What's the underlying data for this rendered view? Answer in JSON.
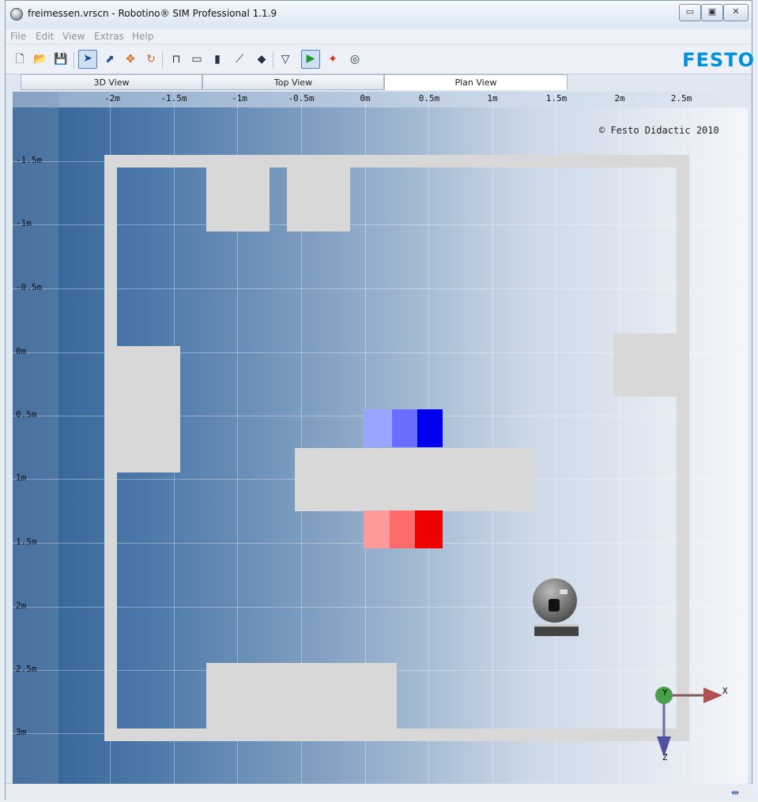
{
  "window": {
    "title": "freimessen.vrscn - Robotino® SIM Professional 1.1.9",
    "minimize_glyph": "▭",
    "maximize_glyph": "▣",
    "close_glyph": "✕"
  },
  "menu": [
    "File",
    "Edit",
    "View",
    "Extras",
    "Help"
  ],
  "toolbar": {
    "icons": [
      "new-file-icon",
      "open-folder-icon",
      "save-icon",
      "select-arrow-icon",
      "pointer-icon",
      "move-icon",
      "rotate-icon",
      "ruler-corner-icon",
      "ruler-icon",
      "marker-icon",
      "line-icon",
      "wall-icon",
      "polygon-icon",
      "play-icon",
      "color-objects-icon",
      "camera-icon"
    ],
    "glyphs": [
      "🗋",
      "📂",
      "💾",
      "➤",
      "⬈",
      "✥",
      "↻",
      "⊓",
      "▭",
      "▮",
      "⟋",
      "◆",
      "▽",
      "▶",
      "✦",
      "◎"
    ]
  },
  "brand": {
    "logo": "FESTO"
  },
  "tabs": [
    {
      "label": "3D View",
      "selected": false
    },
    {
      "label": "Top View",
      "selected": false
    },
    {
      "label": "Plan View",
      "selected": true
    }
  ],
  "plan": {
    "x_ticks": [
      "-2m",
      "-1.5m",
      "-1m",
      "-0.5m",
      "0m",
      "0.5m",
      "1m",
      "1.5m",
      "2m",
      "2.5m"
    ],
    "y_ticks": [
      "-1.5m",
      "-1m",
      "-0.5m",
      "0m",
      "0.5m",
      "1m",
      "1.5m",
      "2m",
      "2.5m",
      "3m"
    ],
    "copyright": "© Festo Didactic 2010",
    "axis_labels": {
      "x": "X",
      "y": "Y",
      "z": "Z"
    },
    "colors": {
      "blue_light": "#9aa5ff",
      "blue_mid": "#6a6dff",
      "blue_dark": "#0000ee",
      "red_light": "#ff9a9a",
      "red_mid": "#ff6a6a",
      "red_dark": "#ee0000",
      "wall": "#d8d8d8"
    }
  },
  "status": {
    "icon": "network-connection-icon",
    "glyph": "⇹"
  }
}
